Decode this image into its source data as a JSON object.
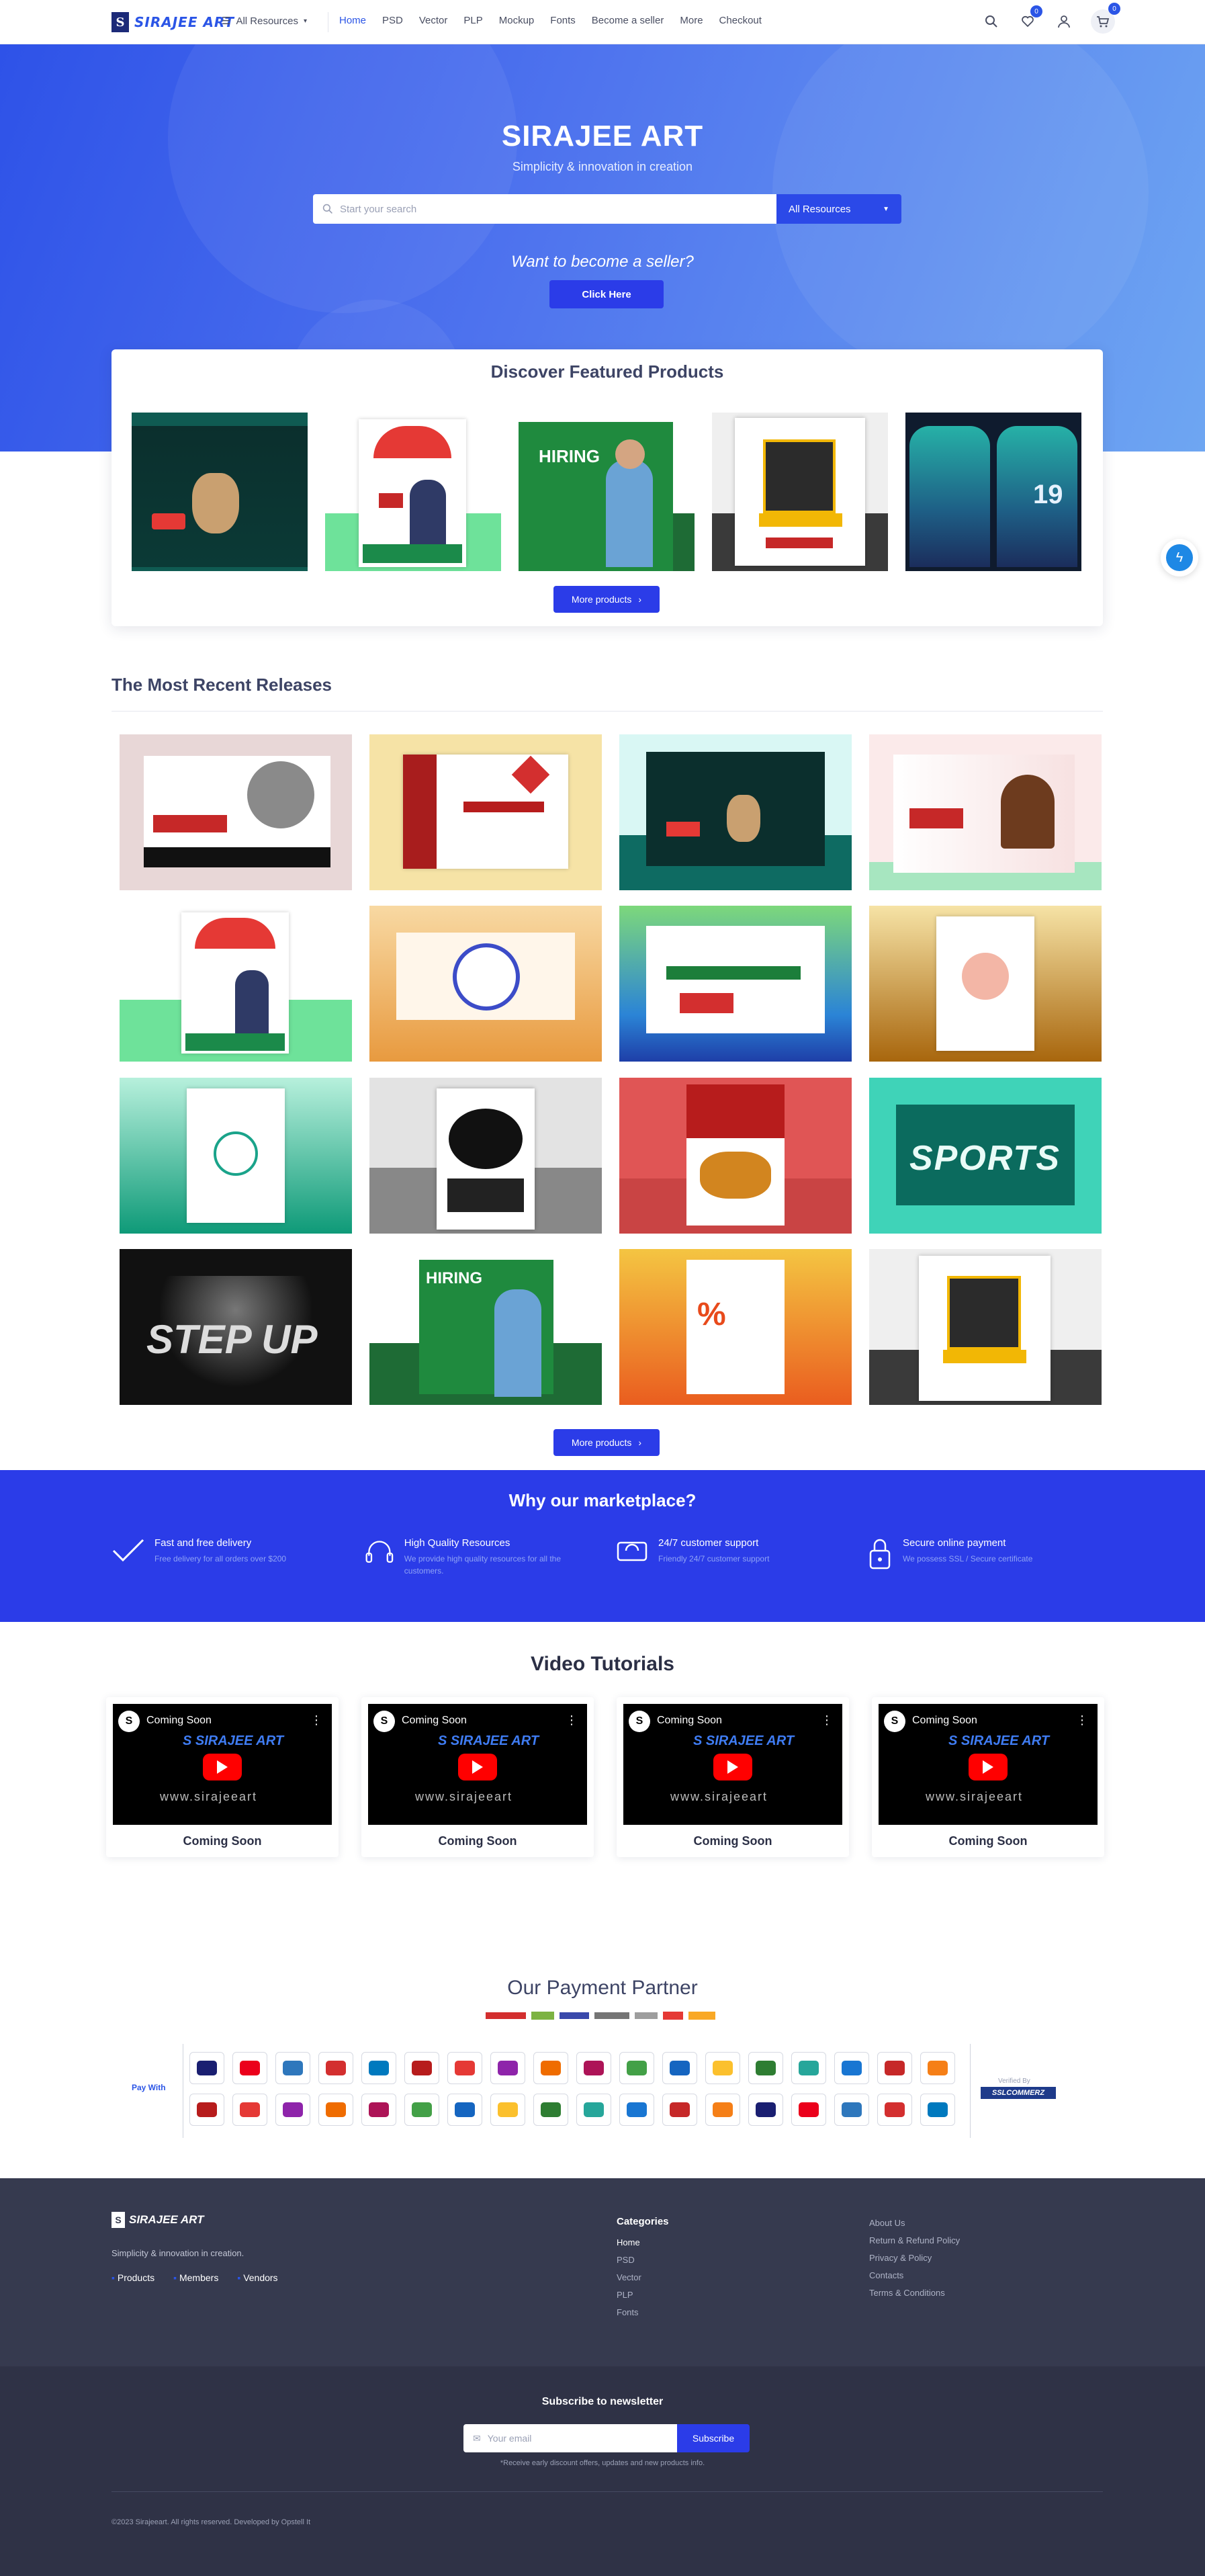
{
  "header": {
    "logo_text": "SIRAJEE ART",
    "category_menu": "All Resources",
    "nav": [
      "Home",
      "PSD",
      "Vector",
      "PLP",
      "Mockup",
      "Fonts",
      "Become a seller",
      "More",
      "Checkout"
    ],
    "wishlist_count": "0",
    "cart_count": "0"
  },
  "hero": {
    "title": "SIRAJEE ART",
    "subtitle": "Simplicity & innovation in creation",
    "search_placeholder": "Start your search",
    "search_category": "All Resources",
    "seller_question": "Want to become a seller?",
    "seller_button": "Click Here"
  },
  "featured": {
    "title": "Discover Featured Products",
    "more_button": "More products"
  },
  "recent": {
    "title": "The Most Recent Releases",
    "more_button": "More products"
  },
  "why": {
    "title": "Why our marketplace?",
    "features": [
      {
        "title": "Fast and free delivery",
        "desc": "Free delivery for all orders over $200"
      },
      {
        "title": "High Quality Resources",
        "desc": "We provide high quality resources for all the customers."
      },
      {
        "title": "24/7 customer support",
        "desc": "Friendly 24/7 customer support"
      },
      {
        "title": "Secure online payment",
        "desc": "We possess SSL / Secure certificate"
      }
    ]
  },
  "videos": {
    "title": "Video Tutorials",
    "items": [
      {
        "label": "Coming Soon",
        "caption": "Coming Soon",
        "site": "www.sirajeeart"
      },
      {
        "label": "Coming Soon",
        "caption": "Coming Soon",
        "site": "www.sirajeeart"
      },
      {
        "label": "Coming Soon",
        "caption": "Coming Soon",
        "site": "www.sirajeeart"
      },
      {
        "label": "Coming Soon",
        "caption": "Coming Soon",
        "site": "www.sirajeeart"
      }
    ]
  },
  "payment": {
    "title": "Our Payment Partner",
    "pay_with": "Pay With",
    "verified_by": "Verified By",
    "verifier": "SSLCOMMERZ"
  },
  "footer": {
    "logo_text": "SIRAJEE ART",
    "tagline": "Simplicity & innovation in creation.",
    "stats": [
      "Products",
      "Members",
      "Vendors"
    ],
    "categories_title": "Categories",
    "categories": [
      "Home",
      "PSD",
      "Vector",
      "PLP",
      "Fonts"
    ],
    "links": [
      "About Us",
      "Return & Refund Policy",
      "Privacy & Policy",
      "Contacts",
      "Terms & Conditions"
    ],
    "newsletter_title": "Subscribe to newsletter",
    "newsletter_placeholder": "Your email",
    "newsletter_button": "Subscribe",
    "newsletter_note": "*Receive early discount offers, updates and new products info.",
    "copyright": "©2023 Sirajeeart. All rights reserved. Developed by Opstell It"
  },
  "colors": {
    "accent": "#2b3ce8",
    "hero_start": "#2e52e8",
    "hero_end": "#6ea6f2",
    "footer": "#363a4f"
  }
}
